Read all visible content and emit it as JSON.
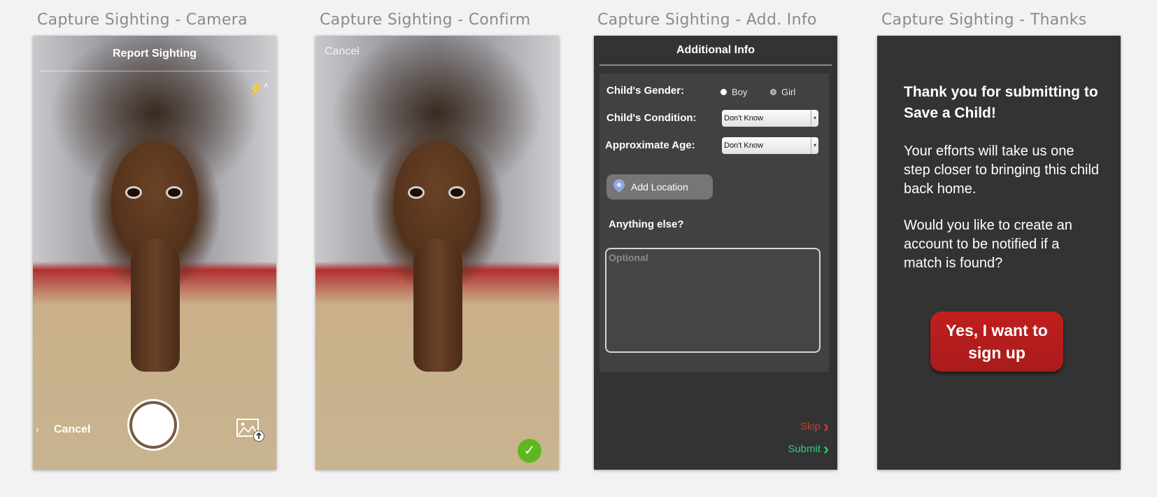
{
  "panels": [
    {
      "title": "Capture Sighting - Camera"
    },
    {
      "title": "Capture Sighting - Confirm"
    },
    {
      "title": "Capture Sighting - Add. Info"
    },
    {
      "title": "Capture Sighting - Thanks"
    }
  ],
  "camera": {
    "header_title": "Report Sighting",
    "flash_icon": "flash-auto-icon",
    "cancel_label": "Cancel",
    "shutter_icon": "shutter-button",
    "gallery_icon": "gallery-upload-icon"
  },
  "confirm": {
    "cancel_label": "Cancel",
    "confirm_icon": "checkmark-icon",
    "confirm_color": "#5cb81e"
  },
  "add_info": {
    "header_title": "Additional Info",
    "gender_label": "Child's Gender:",
    "gender_options": [
      "Boy",
      "Girl"
    ],
    "condition_label": "Child's Condition:",
    "condition_value": "Don't Know",
    "age_label": "Approximate Age:",
    "age_value": "Don't Know",
    "add_location_label": "Add Location",
    "anything_else_label": "Anything else?",
    "notes_placeholder": "Optional",
    "skip_label": "Skip",
    "submit_label": "Submit",
    "skip_color": "#d23a2e",
    "submit_color": "#22d07a"
  },
  "thanks": {
    "heading": "Thank you for submitting to Save a Child!",
    "paragraph_1": "Your efforts will take us one step closer to bringing this child back home.",
    "paragraph_2": "Would you like to create an account to be notified if a match is found?",
    "cta_label": "Yes, I want to sign up",
    "cta_color": "#b71c1c"
  }
}
